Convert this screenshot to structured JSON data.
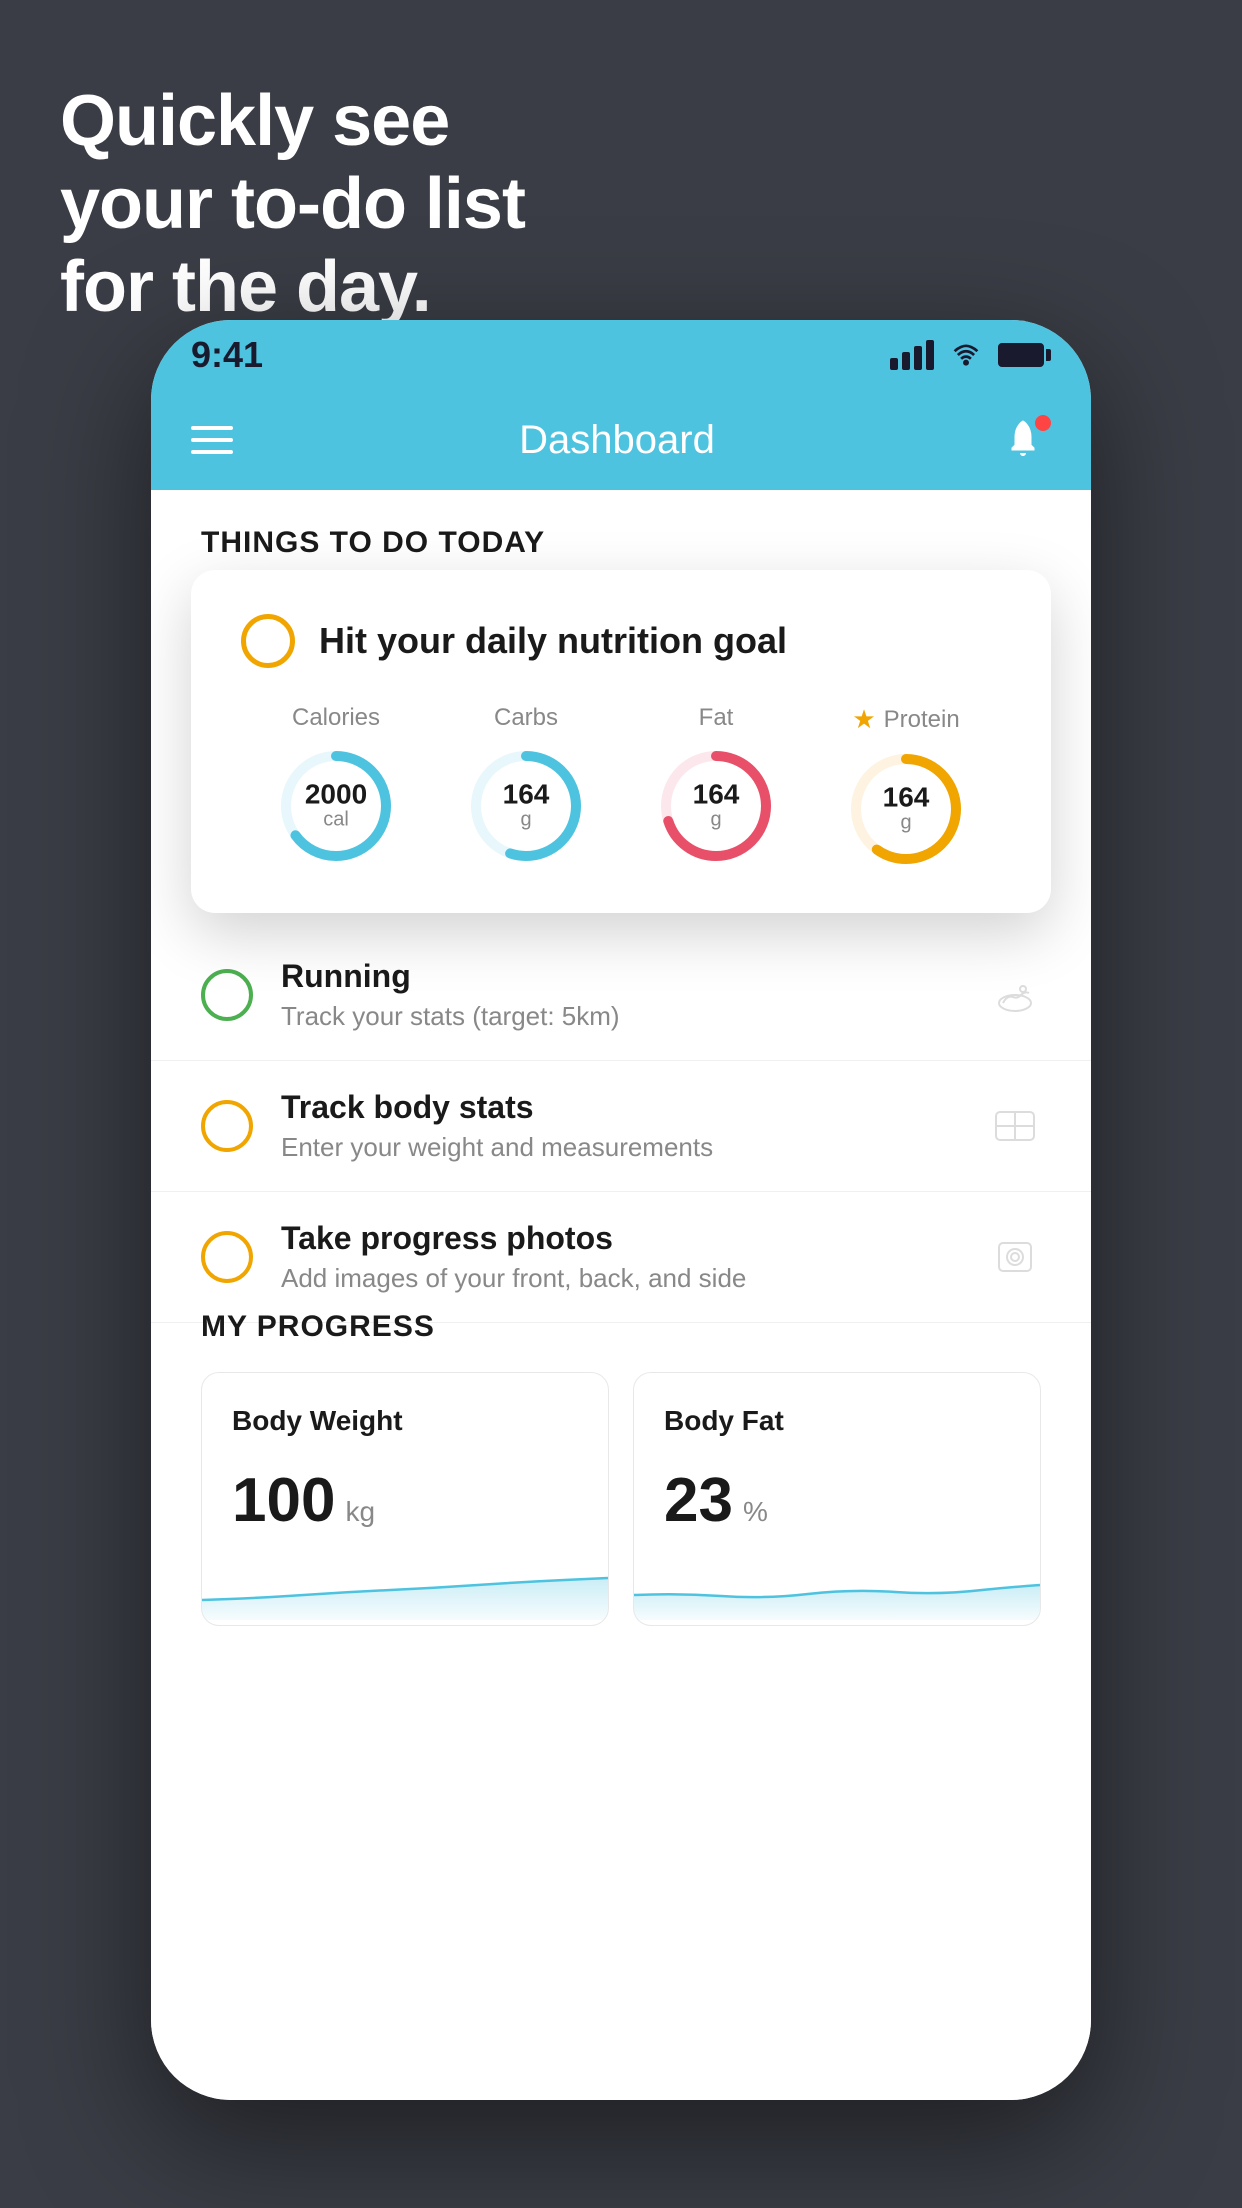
{
  "background": {
    "color": "#3a3d45"
  },
  "headline": {
    "line1": "Quickly see",
    "line2": "your to-do list",
    "line3": "for the day."
  },
  "phone": {
    "status_bar": {
      "time": "9:41"
    },
    "header": {
      "title": "Dashboard"
    },
    "section_heading": "THINGS TO DO TODAY",
    "nutrition_card": {
      "title": "Hit your daily nutrition goal",
      "macros": [
        {
          "label": "Calories",
          "value": "2000",
          "unit": "cal",
          "color": "#4ec3e0",
          "progress": 65
        },
        {
          "label": "Carbs",
          "value": "164",
          "unit": "g",
          "color": "#4ec3e0",
          "progress": 55
        },
        {
          "label": "Fat",
          "value": "164",
          "unit": "g",
          "color": "#e8506a",
          "progress": 70
        },
        {
          "label": "Protein",
          "value": "164",
          "unit": "g",
          "color": "#f0a500",
          "progress": 60,
          "starred": true
        }
      ]
    },
    "todo_items": [
      {
        "id": "running",
        "title": "Running",
        "subtitle": "Track your stats (target: 5km)",
        "circle_color": "green",
        "icon": "👟"
      },
      {
        "id": "body-stats",
        "title": "Track body stats",
        "subtitle": "Enter your weight and measurements",
        "circle_color": "yellow",
        "icon": "⚖"
      },
      {
        "id": "progress-photos",
        "title": "Take progress photos",
        "subtitle": "Add images of your front, back, and side",
        "circle_color": "yellow",
        "icon": "🖼"
      }
    ],
    "progress_section": {
      "heading": "MY PROGRESS",
      "cards": [
        {
          "title": "Body Weight",
          "value": "100",
          "unit": "kg"
        },
        {
          "title": "Body Fat",
          "value": "23",
          "unit": "%"
        }
      ]
    }
  }
}
